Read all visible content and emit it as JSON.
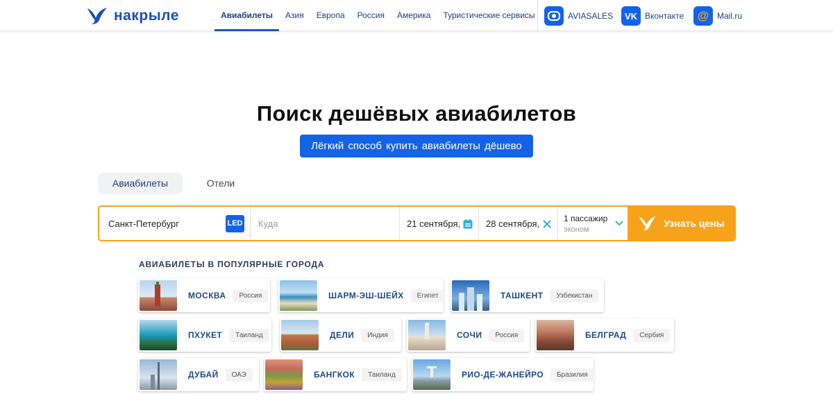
{
  "header": {
    "logo_text": "накрыле",
    "nav": [
      {
        "label": "Авиабилеты",
        "active": true
      },
      {
        "label": "Азия"
      },
      {
        "label": "Европа"
      },
      {
        "label": "Россия"
      },
      {
        "label": "Америка"
      },
      {
        "label": "Туристические сервисы"
      }
    ],
    "partners": [
      {
        "label": "AVIASALES",
        "icon": "aviasales-icon"
      },
      {
        "label": "Вконтакте",
        "icon": "vk-icon"
      },
      {
        "label": "Mail.ru",
        "icon": "mailru-icon"
      }
    ]
  },
  "hero": {
    "title": "Поиск дешёвых авиабилетов",
    "button_label": "Лёгкий способ купить авиабилеты дёшево"
  },
  "tabs": [
    {
      "label": "Авиабилеты",
      "active": true
    },
    {
      "label": "Отели"
    }
  ],
  "search": {
    "from_value": "Санкт-Петербург",
    "from_iata": "LED",
    "to_placeholder": "Куда",
    "depart_date": "21 сентября,",
    "return_date": "28 сентября,",
    "passengers": "1 пассажир",
    "class": "эконом",
    "submit_label": "Узнать цены"
  },
  "popular": {
    "title": "АВИАБИЛЕТЫ В ПОПУЛЯРНЫЕ ГОРОДА",
    "cities": [
      {
        "city": "МОСКВА",
        "country": "Россия"
      },
      {
        "city": "ШАРМ-ЭШ-ШЕЙХ",
        "country": "Египет"
      },
      {
        "city": "ТАШКЕНТ",
        "country": "Узбекистан"
      },
      {
        "city": "ПХУКЕТ",
        "country": "Таиланд"
      },
      {
        "city": "ДЕЛИ",
        "country": "Индия"
      },
      {
        "city": "СОЧИ",
        "country": "Россия"
      },
      {
        "city": "БЕЛГРАД",
        "country": "Сербия"
      },
      {
        "city": "ДУБАЙ",
        "country": "ОАЭ"
      },
      {
        "city": "БАНГКОК",
        "country": "Таиланд"
      },
      {
        "city": "РИО-ДЕ-ЖАНЕЙРО",
        "country": "Бразилия"
      }
    ]
  },
  "colors": {
    "brand_blue": "#1463e6",
    "accent_orange": "#f7a21b",
    "nav_text": "#1d3f7a"
  }
}
